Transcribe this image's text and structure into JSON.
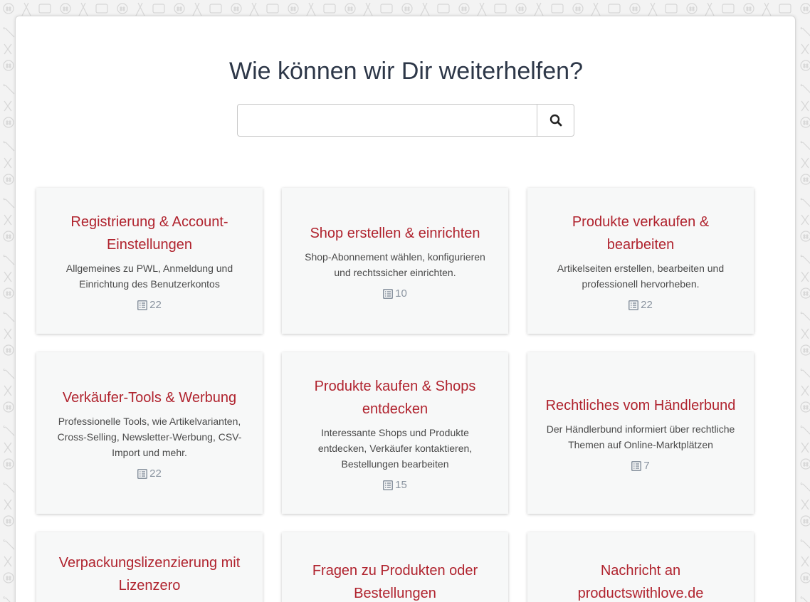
{
  "page": {
    "headline": "Wie können wir Dir weiterhelfen?"
  },
  "search": {
    "placeholder": "",
    "value": "",
    "button_icon": "search-icon"
  },
  "colors": {
    "title_red": "#b0232e",
    "count_gray": "#8a94a0",
    "card_bg": "#f7f8f8"
  },
  "categories": [
    {
      "title": "Registrierung & Account-Einstellungen",
      "description": "Allgemeines zu PWL, Anmeldung und Einrichtung des Benutzerkontos",
      "count": "22",
      "icon": "list-document-icon"
    },
    {
      "title": "Shop erstellen & einrichten",
      "description": "Shop-Abonnement wählen, konfigurieren und rechtssicher einrichten.",
      "count": "10",
      "icon": "list-document-icon"
    },
    {
      "title": "Produkte verkaufen & bearbeiten",
      "description": "Artikelseiten erstellen, bearbeiten und professionell hervorheben.",
      "count": "22",
      "icon": "list-document-icon"
    },
    {
      "title": "Verkäufer-Tools & Werbung",
      "description": "Professionelle Tools, wie Artikelvarianten, Cross-Selling, Newsletter-Werbung, CSV-Import und mehr.",
      "count": "22",
      "icon": "list-document-icon"
    },
    {
      "title": "Produkte kaufen & Shops entdecken",
      "description": "Interessante Shops und Produkte entdecken, Verkäufer kontaktieren, Bestellungen bearbeiten",
      "count": "15",
      "icon": "list-document-icon"
    },
    {
      "title": "Rechtliches vom Händlerbund",
      "description": "Der Händlerbund informiert über rechtliche Themen auf Online-Marktplätzen",
      "count": "7",
      "icon": "list-document-icon"
    },
    {
      "title": "Verpackungslizenzierung mit Lizenzero"
    },
    {
      "title": "Fragen zu Produkten oder Bestellungen"
    },
    {
      "title": "Nachricht an productswithlove.de"
    }
  ]
}
